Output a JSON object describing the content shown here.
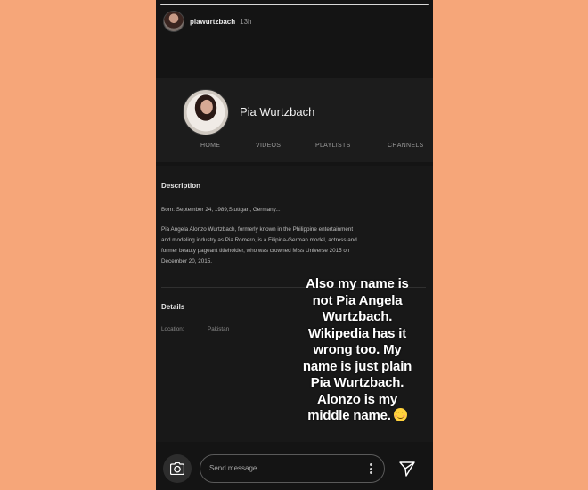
{
  "story": {
    "username": "piawurtzbach",
    "time": "13h",
    "progress": 1.0
  },
  "channel": {
    "name": "Pia Wurtzbach",
    "tabs": [
      "HOME",
      "VIDEOS",
      "PLAYLISTS",
      "CHANNELS"
    ]
  },
  "description": {
    "title": "Description",
    "born": "Born: September 24, 1989,Stuttgart, Germany...",
    "bio_lines": [
      "Pia Angela Alonzo Wurtzbach, formerly known in the Philippine entertainment",
      "and modeling industry as Pia Romero, is a Filipina-German model, actress and",
      "former beauty pageant titleholder, who was crowned Miss Universe 2015 on",
      "December 20, 2015."
    ]
  },
  "details": {
    "title": "Details",
    "location_label": "Location:",
    "location_value": "Pakistan"
  },
  "overlay_text": {
    "lines": [
      "Also my name is",
      "not Pia Angela",
      "Wurtzbach.",
      "Wikipedia has it",
      "wrong too. My",
      "name is just plain",
      "Pia Wurtzbach.",
      "Alonzo is my",
      "middle name."
    ],
    "emoji": "smiling-face-icon"
  },
  "reply_bar": {
    "placeholder": "Send message",
    "camera_icon": "camera-icon",
    "more_icon": "more-options-icon",
    "send_icon": "send-icon"
  },
  "colors": {
    "background": "#f6a679",
    "phone": "#141414"
  }
}
